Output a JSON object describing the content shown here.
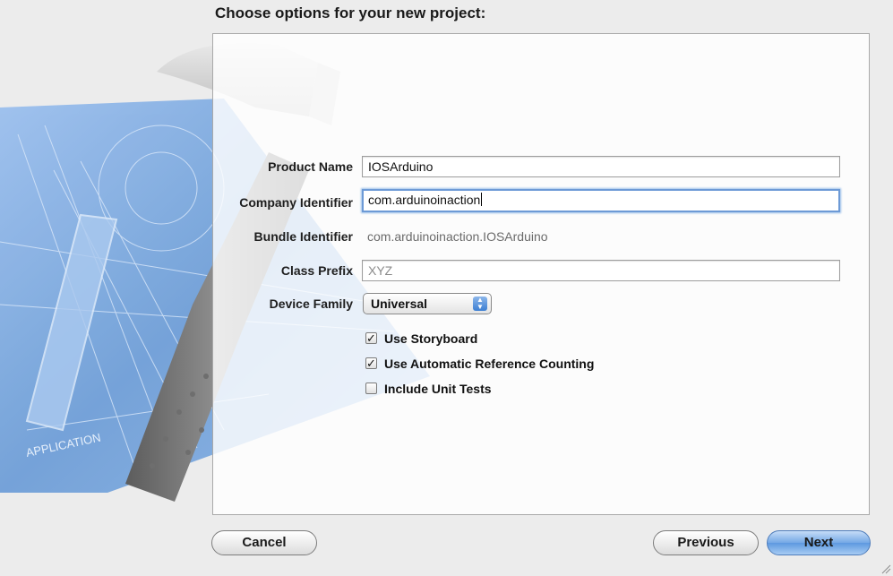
{
  "title": "Choose options for your new project:",
  "form": {
    "product_name": {
      "label": "Product Name",
      "value": "IOSArduino"
    },
    "company_identifier": {
      "label": "Company Identifier",
      "value": "com.arduinoinaction"
    },
    "bundle_identifier": {
      "label": "Bundle Identifier",
      "value": "com.arduinoinaction.IOSArduino"
    },
    "class_prefix": {
      "label": "Class Prefix",
      "placeholder": "XYZ"
    },
    "device_family": {
      "label": "Device Family",
      "value": "Universal"
    },
    "checkboxes": [
      {
        "label": "Use Storyboard",
        "checked": true
      },
      {
        "label": "Use Automatic Reference Counting",
        "checked": true
      },
      {
        "label": "Include Unit Tests",
        "checked": false
      }
    ]
  },
  "blueprint_text": "APPLICATION",
  "buttons": {
    "cancel": "Cancel",
    "previous": "Previous",
    "next": "Next"
  },
  "colors": {
    "accent": "#5e99e0",
    "focus_ring": "#6d9ad6",
    "blueprint": "#6f9fd8"
  },
  "icons": {
    "popup_arrows": "up-down-arrows-icon",
    "checkmark": "checkmark-icon",
    "resize": "resize-grip-icon"
  }
}
